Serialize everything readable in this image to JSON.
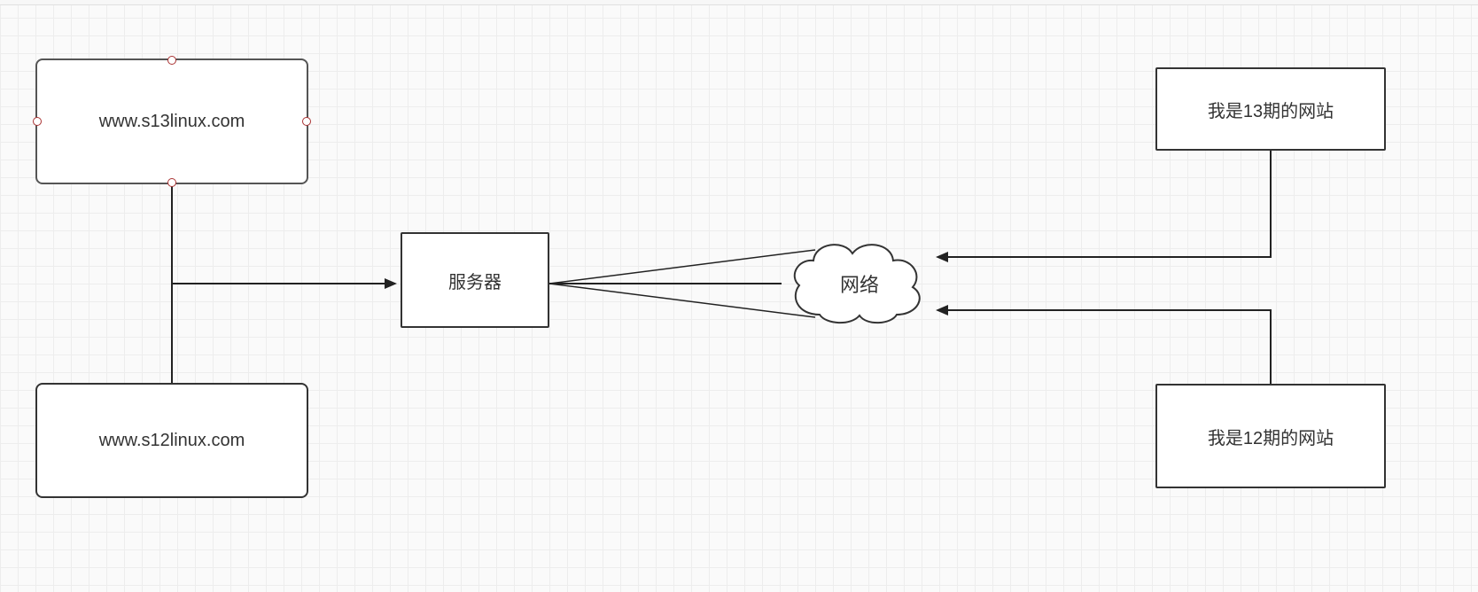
{
  "nodes": {
    "site13": {
      "label": "www.s13linux.com"
    },
    "site12": {
      "label": "www.s12linux.com"
    },
    "server": {
      "label": "服务器"
    },
    "network": {
      "label": "网络"
    },
    "client13": {
      "label": "我是13期的网站"
    },
    "client12": {
      "label": "我是12期的网站"
    }
  }
}
